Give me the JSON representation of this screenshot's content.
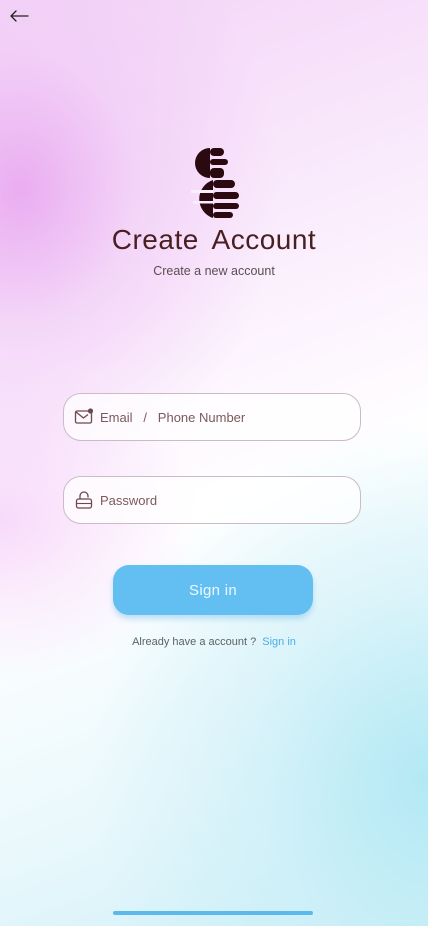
{
  "header": {
    "back_icon": "arrow-left-icon"
  },
  "brand": {
    "logo_icon": "brand-logo-icon",
    "color": "#2a0a10"
  },
  "title": "Create  Account",
  "subtitle": "Create a new account",
  "form": {
    "email": {
      "icon": "mail-icon",
      "placeholder": "Email   /   Phone Number"
    },
    "password": {
      "icon": "lock-icon",
      "placeholder": "Password"
    },
    "submit_label": "Sign in"
  },
  "footer": {
    "prompt": "Already have a account ?",
    "link_label": "Sign in"
  },
  "colors": {
    "accent": "#63bff2",
    "title": "#4a1f22",
    "link": "#4aaee8"
  }
}
